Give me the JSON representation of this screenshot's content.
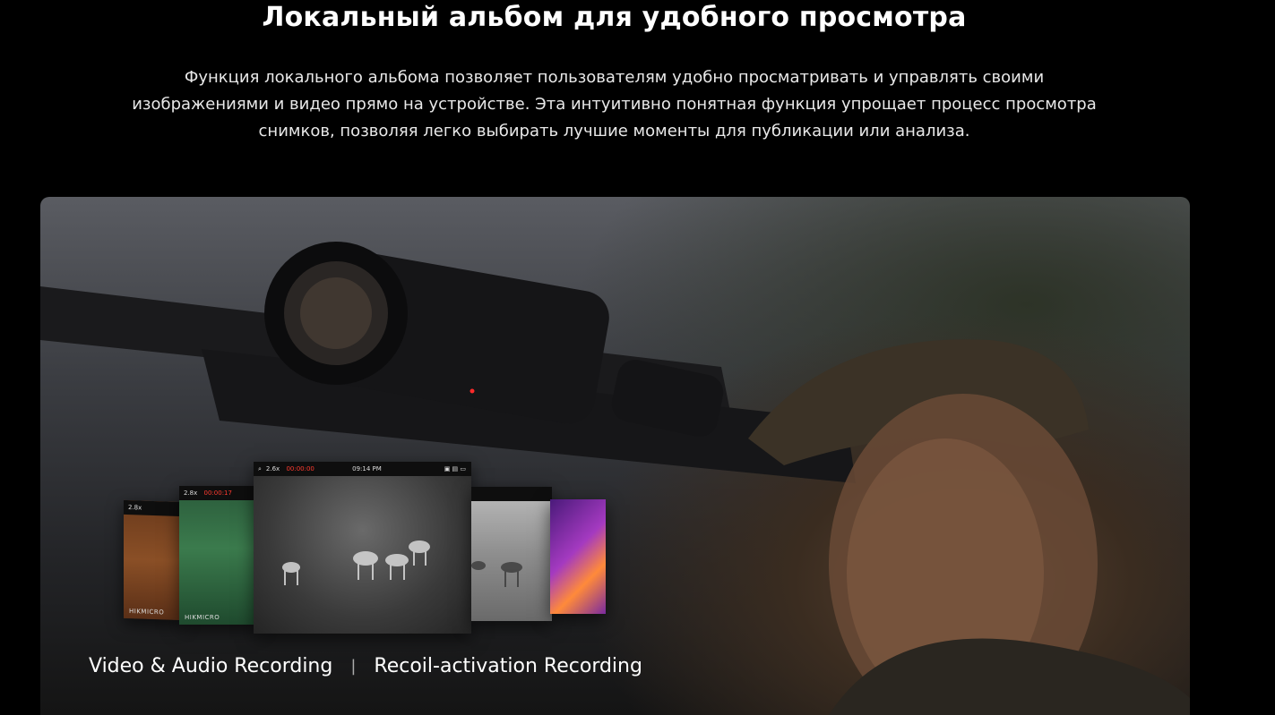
{
  "heading": "Локальный альбом для удобного просмотра",
  "description": "Функция локального альбома позволяет пользователям удобно просматривать и управлять своими изображениями и видео прямо на устройстве. Эта интуитивно понятная функция упрощает процесс просмотра снимков, позволяя легко выбирать лучшие моменты для публикации или анализа.",
  "hero": {
    "features": [
      "Video & Audio Recording",
      "Recoil-activation Recording"
    ],
    "separator": "|",
    "screens": {
      "main": {
        "zoom": "2.6x",
        "timer": "00:00:00",
        "clock": "09:14 PM"
      },
      "green": {
        "zoom": "2.8x",
        "timer": "00:00:17",
        "brand": "HIKMICRO"
      },
      "orange": {
        "zoom": "2.8x",
        "brand": "HIKMICRO"
      }
    }
  }
}
